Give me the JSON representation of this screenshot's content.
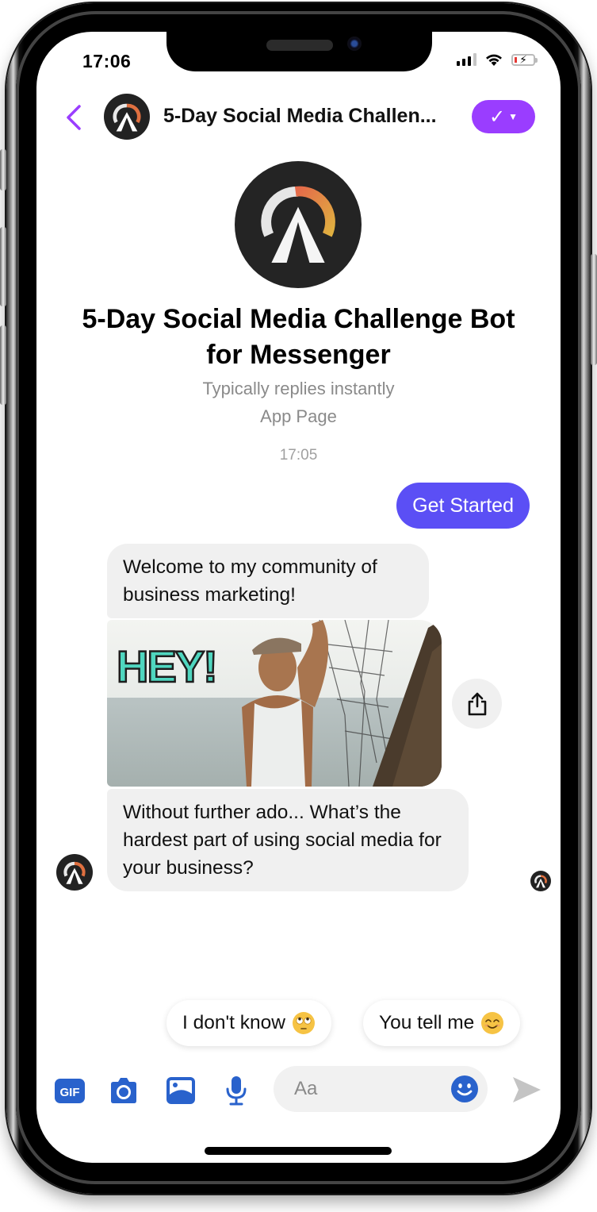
{
  "status_bar": {
    "time": "17:06",
    "icons": [
      "cellular-signal-icon",
      "wifi-icon",
      "battery-charging-icon"
    ]
  },
  "header": {
    "back_icon": "chevron-left-icon",
    "title": "5-Day Social Media Challen...",
    "verify_button_icon": "checkmark-dropdown-icon"
  },
  "profile": {
    "name": "5-Day Social Media Challenge Bot for Messenger",
    "reply_time": "Typically replies instantly",
    "page_type": "App Page"
  },
  "conversation": {
    "timestamp": "17:05",
    "messages": [
      {
        "sender": "user",
        "type": "text",
        "text": "Get Started"
      },
      {
        "sender": "bot",
        "type": "text",
        "text": "Welcome to my community of business marketing!"
      },
      {
        "sender": "bot",
        "type": "gif",
        "caption_text": "HEY!"
      },
      {
        "sender": "bot",
        "type": "text",
        "text": "Without further ado... What’s the hardest part of using social media for your business?"
      }
    ],
    "share_icon": "share-icon"
  },
  "quick_replies": [
    {
      "label": "I don't know",
      "emoji": "face-with-rolling-eyes"
    },
    {
      "label": "You tell me",
      "emoji": "smiling-face-with-smiling-eyes"
    }
  ],
  "composer": {
    "tools": [
      "gif-icon",
      "camera-icon",
      "image-icon",
      "microphone-icon"
    ],
    "placeholder": "Aa",
    "value": "",
    "emoji_icon": "emoji-icon",
    "send_icon": "send-icon"
  },
  "colors": {
    "accent_purple": "#9a3dff",
    "user_bubble": "#5b4ff5",
    "bot_bubble": "#f0f0f0",
    "tool_blue": "#2962cc",
    "back_chevron": "#9a3dff"
  }
}
